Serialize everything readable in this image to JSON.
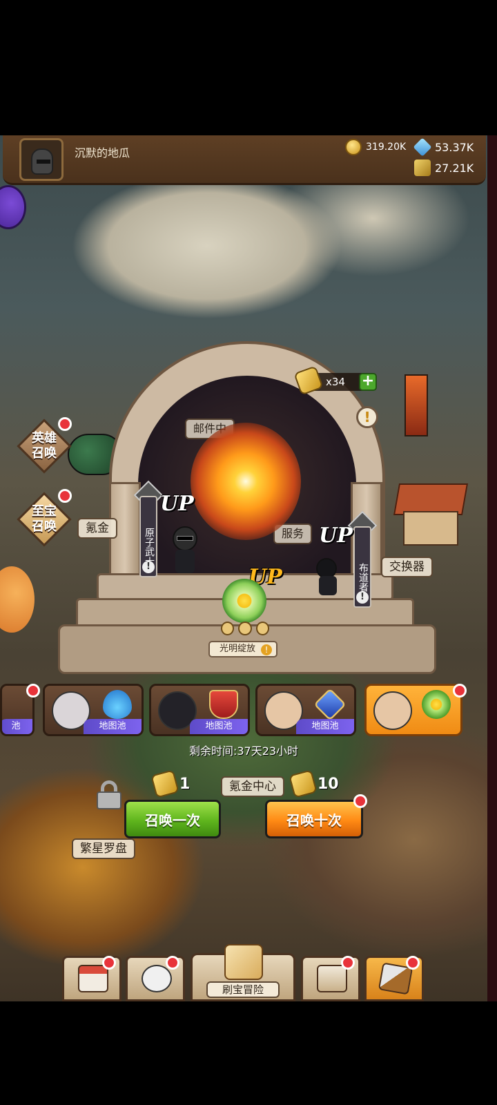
{
  "player": {
    "name": "沉默的地瓜"
  },
  "resources": {
    "gold": "319.20K",
    "gems": "53.37K",
    "tickets": "27.21K"
  },
  "side_buttons": {
    "hero_summon": "英雄召唤",
    "treasure_summon": "至宝召唤"
  },
  "portal": {
    "ticket_count": "x34",
    "plus": "+",
    "info": "!"
  },
  "map_labels": {
    "mail": "邮件中",
    "krypton": "氪金",
    "mission": "服务",
    "exchanger": "交换器",
    "star_compass": "繁星罗盘"
  },
  "up_heroes": [
    {
      "up": "UP",
      "name": "原子武士"
    },
    {
      "up": "UP",
      "name": "布道者"
    }
  ],
  "featured": {
    "up": "UP",
    "name": "光明绽放"
  },
  "pools": [
    {
      "label": "池"
    },
    {
      "label": "地图池",
      "emblem": "water-drop-icon"
    },
    {
      "label": "地图池",
      "emblem": "shield-sword-icon"
    },
    {
      "label": "地图池",
      "emblem": "blue-gem-icon"
    },
    {
      "label": "",
      "emblem": "flower-icon"
    }
  ],
  "remaining_time": "剩余时间:37天23小时",
  "summon": {
    "once_cost": "1",
    "ten_cost": "10",
    "krypton_center": "氪金中心",
    "once_label": "召唤一次",
    "ten_label": "召唤十次"
  },
  "bottom_nav": {
    "center_label": "刷宝冒险"
  },
  "colors": {
    "accent_orange": "#ff8a14",
    "accent_green": "#5fb51d",
    "notification_red": "#e8333a"
  }
}
